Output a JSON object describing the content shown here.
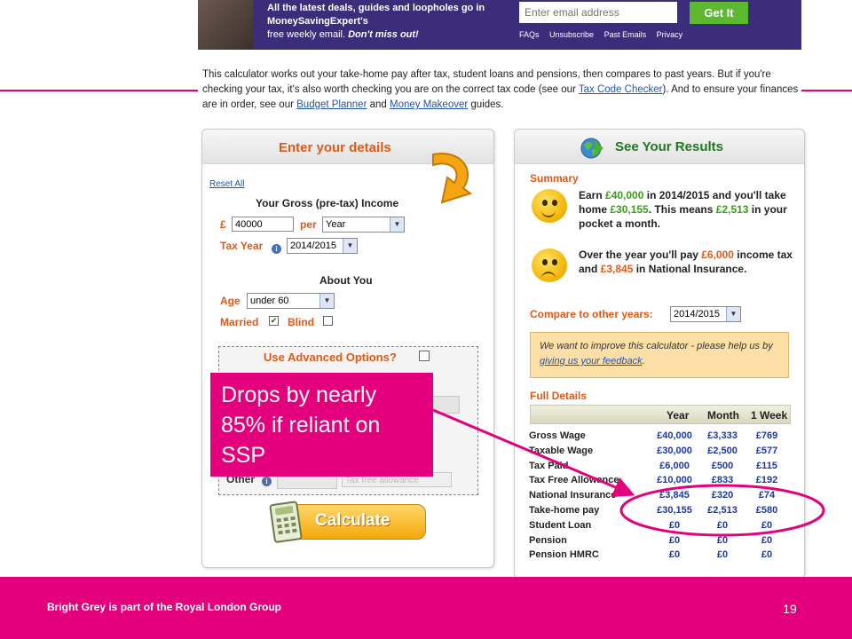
{
  "banner": {
    "line1": "All the latest deals, guides and loopholes go in",
    "line2": "MoneySavingExpert's",
    "line3a": "free weekly email. ",
    "line3b": "Don't miss out!",
    "email_placeholder": "Enter email address",
    "button": "Get It",
    "links": [
      "FAQs",
      "Unsubscribe",
      "Past Emails",
      "Privacy"
    ]
  },
  "intro": {
    "p1": "This calculator works out your take-home pay after tax, student loans and pensions, then compares to past years. But if you're checking your tax, it's also worth checking you are on the correct tax code (see our ",
    "link1": "Tax Code Checker",
    "p2": "). And to ensure your finances are in order, see our ",
    "link2": "Budget Planner",
    "p3": " and ",
    "link3": "Money Makeover",
    "p4": " guides."
  },
  "left_panel": {
    "title": "Enter your details",
    "reset": "Reset All",
    "gross_title": "Your Gross (pre-tax) Income",
    "currency": "£",
    "income_value": "40000",
    "per_label": "per",
    "period": "Year",
    "tax_year_label": "Tax Year",
    "tax_year": "2014/2015",
    "about_title": "About You",
    "age_label": "Age",
    "age_value": "under 60",
    "married_label": "Married",
    "married_checked": "✔",
    "blind_label": "Blind",
    "advanced_label": "Use Advanced Options?",
    "other_label": "Other",
    "other_select": "Tax free allowance",
    "calculate": "Calculate"
  },
  "right_panel": {
    "title": "See Your Results",
    "summary_title": "Summary",
    "s1_a": "Earn ",
    "s1_b": "£40,000",
    "s1_c": " in 2014/2015 and you'll take home ",
    "s1_d": "£30,155",
    "s1_e": ". This means ",
    "s1_f": "£2,513",
    "s1_g": " in your pocket a month.",
    "s2_a": "Over the year you'll pay ",
    "s2_b": "£6,000",
    "s2_c": " income tax and ",
    "s2_d": "£3,845",
    "s2_e": " in National Insurance.",
    "compare_label": "Compare to other years:",
    "compare_year": "2014/2015",
    "feedback_a": "We want to improve this calculator - please help us by ",
    "feedback_link": "giving us your feedback",
    "feedback_b": ".",
    "full_details": "Full Details",
    "columns": [
      "Year",
      "Month",
      "1 Week"
    ],
    "rows": [
      {
        "label": "Gross Wage",
        "year": "£40,000",
        "month": "£3,333",
        "week": "£769"
      },
      {
        "label": "Taxable Wage",
        "year": "£30,000",
        "month": "£2,500",
        "week": "£577"
      },
      {
        "label": "Tax Paid",
        "year": "£6,000",
        "month": "£500",
        "week": "£115"
      },
      {
        "label": "Tax Free Allowance",
        "year": "£10,000",
        "month": "£833",
        "week": "£192"
      },
      {
        "label": "National Insurance",
        "year": "£3,845",
        "month": "£320",
        "week": "£74"
      },
      {
        "label": "Take-home pay",
        "year": "£30,155",
        "month": "£2,513",
        "week": "£580"
      },
      {
        "label": "Student Loan",
        "year": "£0",
        "month": "£0",
        "week": "£0"
      },
      {
        "label": "Pension",
        "year": "£0",
        "month": "£0",
        "week": "£0"
      },
      {
        "label": "Pension HMRC",
        "year": "£0",
        "month": "£0",
        "week": "£0"
      }
    ]
  },
  "callout": "Drops by nearly 85% if reliant on SSP",
  "footer": {
    "text": "Bright Grey is part of the Royal London Group",
    "page": "19"
  },
  "colors": {
    "brand_pink": "#e4007d",
    "banner_purple": "#3b2d7a",
    "accent_orange": "#e05a16",
    "value_blue": "#1a38a8"
  }
}
